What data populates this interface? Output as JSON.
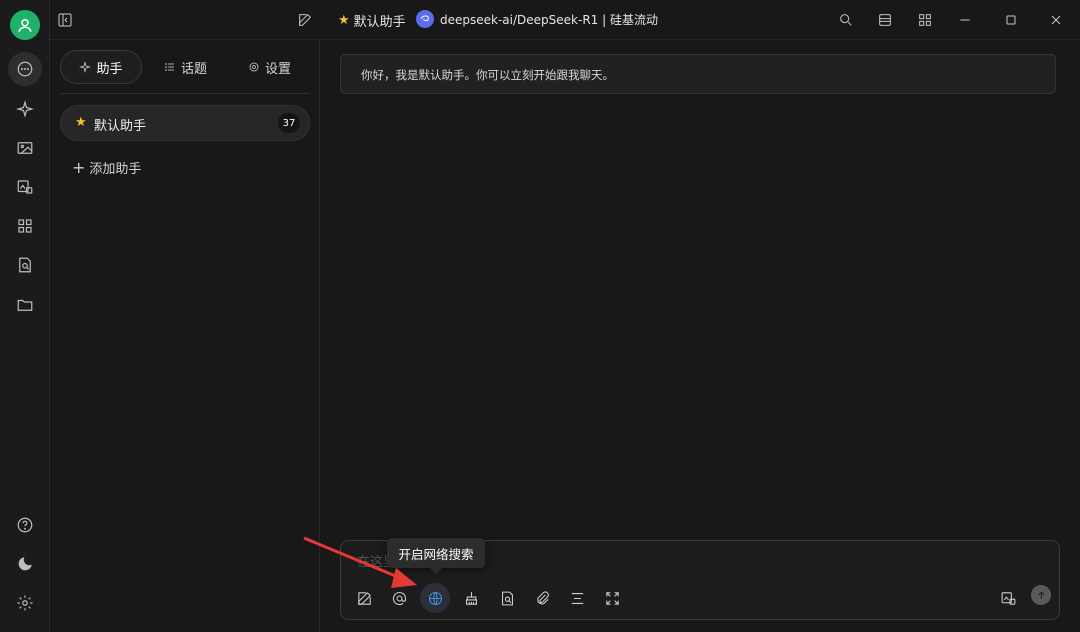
{
  "window": {
    "active_assistant": "默认助手",
    "model_name": "deepseek-ai/DeepSeek-R1 | 硅基流动"
  },
  "sidebar_tabs": [
    {
      "label": "助手",
      "icon": "sparkle-icon",
      "active": true
    },
    {
      "label": "话题",
      "icon": "list-icon",
      "active": false
    },
    {
      "label": "设置",
      "icon": "gear-icon",
      "active": false
    }
  ],
  "assistants": [
    {
      "name": "默认助手",
      "count": "37"
    }
  ],
  "add_assistant_label": "添加助手",
  "chat": {
    "welcome_message": "你好，我是默认助手。你可以立刻开始跟我聊天。",
    "input_placeholder": "在这里输入消息...",
    "tooltip": "开启网络搜索"
  },
  "colors": {
    "accent_green": "#20b26b",
    "star": "#f2c230",
    "web_search_highlight": "#4a90e2",
    "annotation_arrow": "#e53935"
  }
}
